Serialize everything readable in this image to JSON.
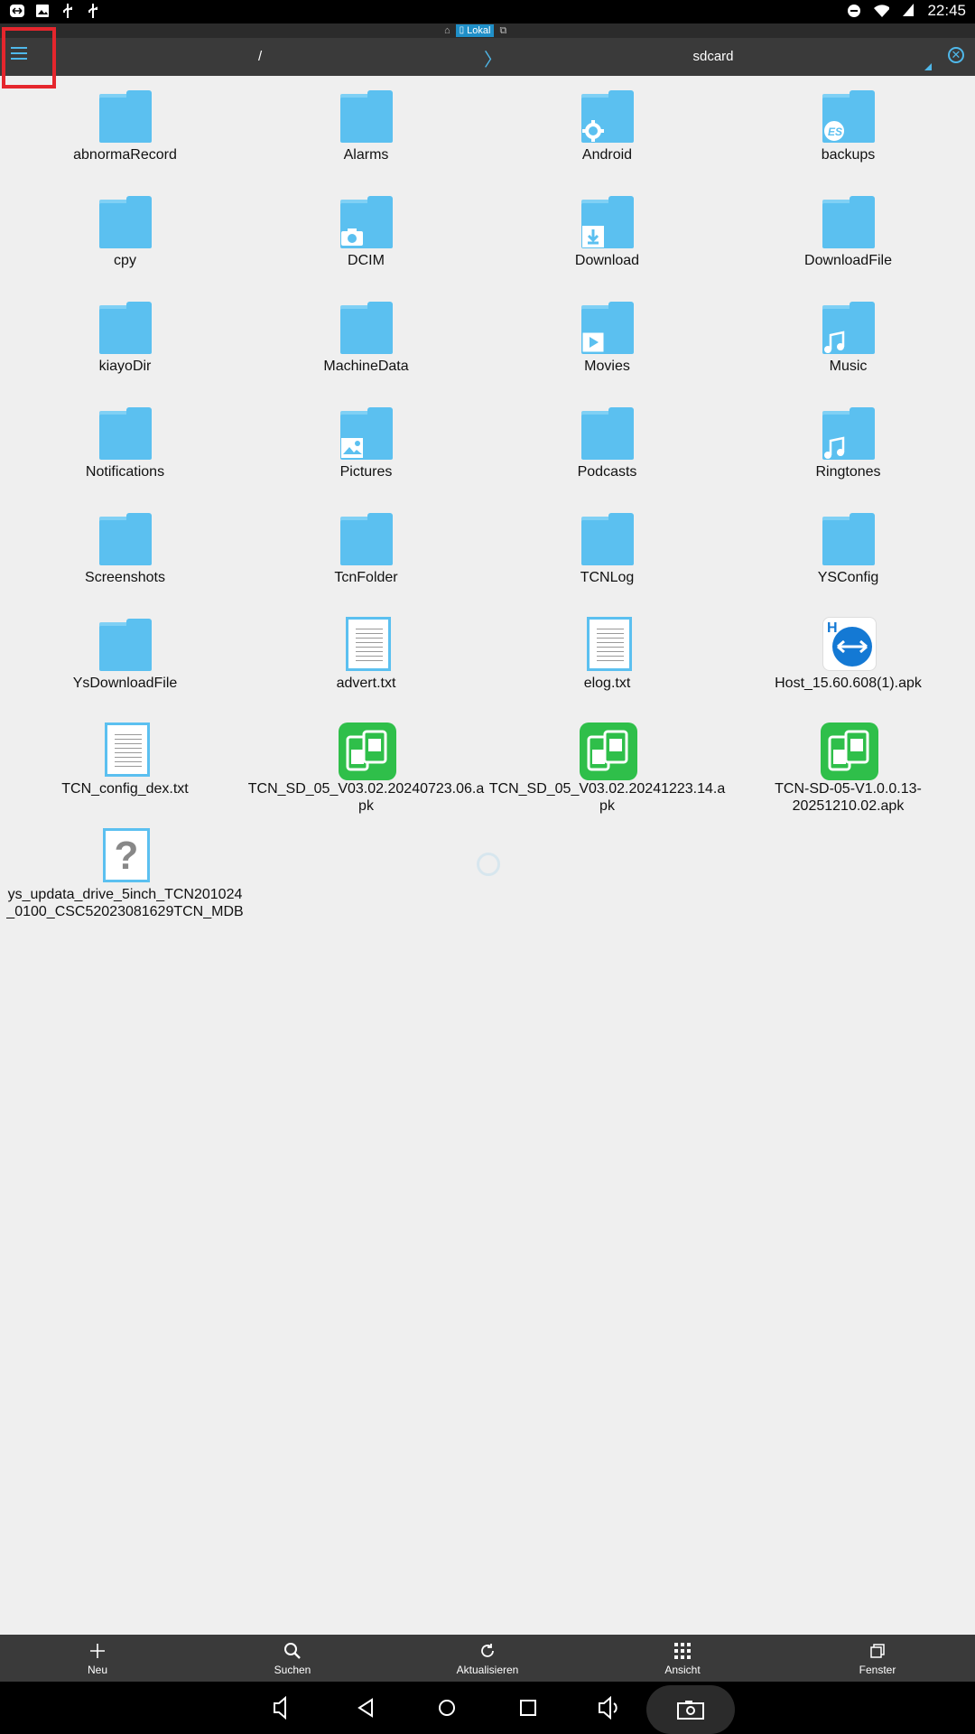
{
  "status_bar": {
    "time": "22:45"
  },
  "location_bar": {
    "label": "Lokal"
  },
  "breadcrumb": {
    "root": "/",
    "separator": "〉",
    "current": "sdcard"
  },
  "items": [
    {
      "label": "abnormaRecord",
      "type": "folder",
      "badge": ""
    },
    {
      "label": "Alarms",
      "type": "folder",
      "badge": ""
    },
    {
      "label": "Android",
      "type": "folder",
      "badge": "gear-icon"
    },
    {
      "label": "backups",
      "type": "folder",
      "badge": "es-icon"
    },
    {
      "label": "cpy",
      "type": "folder",
      "badge": ""
    },
    {
      "label": "DCIM",
      "type": "folder",
      "badge": "camera-icon"
    },
    {
      "label": "Download",
      "type": "folder",
      "badge": "download-icon"
    },
    {
      "label": "DownloadFile",
      "type": "folder",
      "badge": ""
    },
    {
      "label": "kiayoDir",
      "type": "folder",
      "badge": ""
    },
    {
      "label": "MachineData",
      "type": "folder",
      "badge": ""
    },
    {
      "label": "Movies",
      "type": "folder",
      "badge": "play-icon"
    },
    {
      "label": "Music",
      "type": "folder",
      "badge": "music-note-icon"
    },
    {
      "label": "Notifications",
      "type": "folder",
      "badge": ""
    },
    {
      "label": "Pictures",
      "type": "folder",
      "badge": "picture-icon"
    },
    {
      "label": "Podcasts",
      "type": "folder",
      "badge": ""
    },
    {
      "label": "Ringtones",
      "type": "folder",
      "badge": "music-note-icon"
    },
    {
      "label": "Screenshots",
      "type": "folder",
      "badge": ""
    },
    {
      "label": "TcnFolder",
      "type": "folder",
      "badge": ""
    },
    {
      "label": "TCNLog",
      "type": "folder",
      "badge": ""
    },
    {
      "label": "YSConfig",
      "type": "folder",
      "badge": ""
    },
    {
      "label": "YsDownloadFile",
      "type": "folder",
      "badge": ""
    },
    {
      "label": "advert.txt",
      "type": "txt",
      "badge": ""
    },
    {
      "label": "elog.txt",
      "type": "txt",
      "badge": ""
    },
    {
      "label": "Host_15.60.608(1).apk",
      "type": "host",
      "badge": ""
    },
    {
      "label": "TCN_config_dex.txt",
      "type": "txt",
      "badge": ""
    },
    {
      "label": "TCN_SD_05_V03.02.20240723.06.apk",
      "type": "apk",
      "badge": ""
    },
    {
      "label": "TCN_SD_05_V03.02.20241223.14.apk",
      "type": "apk",
      "badge": ""
    },
    {
      "label": "TCN-SD-05-V1.0.0.13-20251210.02.apk",
      "type": "apk",
      "badge": ""
    },
    {
      "label": "ys_updata_drive_5inch_TCN201024_0100_CSC52023081629TCN_MDB",
      "type": "unknown",
      "badge": ""
    }
  ],
  "toolbar": {
    "new": "Neu",
    "search": "Suchen",
    "refresh": "Aktualisieren",
    "view": "Ansicht",
    "window": "Fenster"
  },
  "colors": {
    "accent": "#4fb8ea",
    "folder": "#5bc0f0",
    "apk": "#2fbf4a",
    "highlight": "#e5262d"
  }
}
